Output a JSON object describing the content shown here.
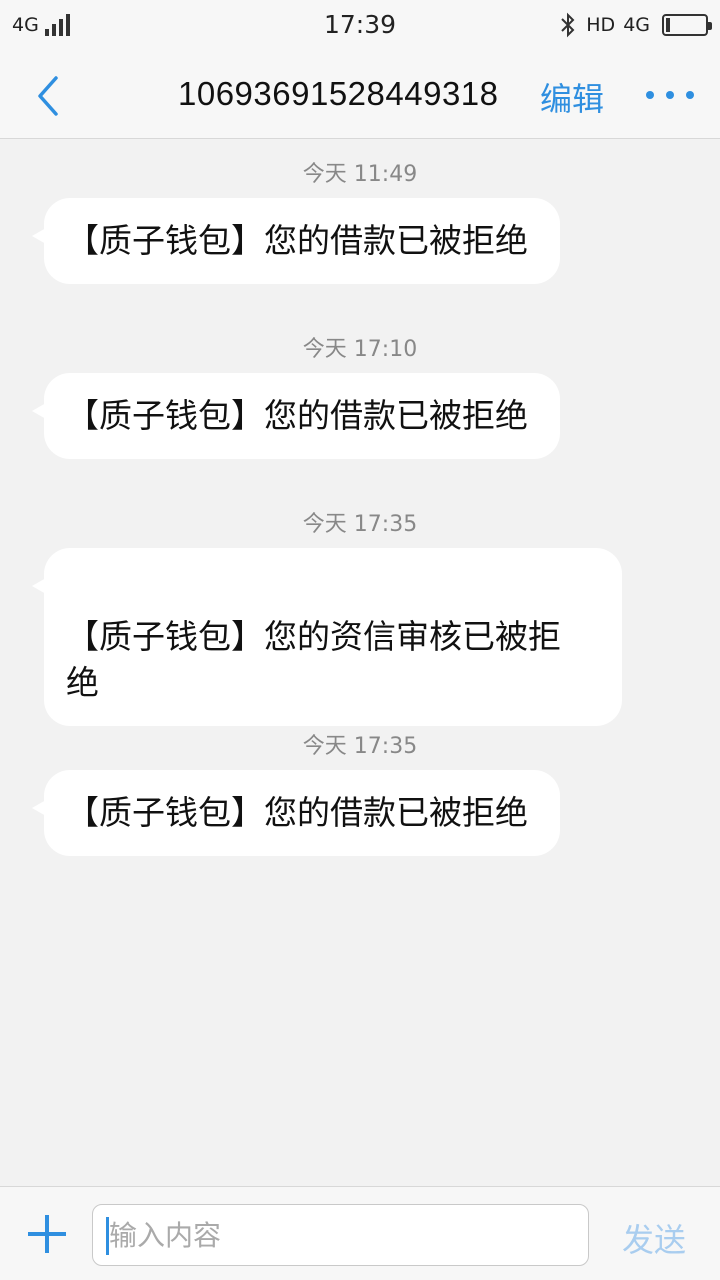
{
  "status_bar": {
    "network": "4G",
    "time": "17:39",
    "hd": "HD",
    "network_right": "4G",
    "icons": [
      "signal-icon",
      "bluetooth-icon",
      "battery-icon"
    ]
  },
  "header": {
    "title": "10693691528449318",
    "edit_label": "编辑",
    "icons": [
      "back-arrow-icon",
      "more-dots-icon"
    ]
  },
  "messages": [
    {
      "time": "今天 11:49",
      "text": "【质子钱包】您的借款已被拒绝"
    },
    {
      "time": "今天 17:10",
      "text": "【质子钱包】您的借款已被拒绝"
    },
    {
      "time": "今天 17:35",
      "text": "【质子钱包】您的资信审核已被拒\n绝"
    },
    {
      "time": "今天 17:35",
      "text": "【质子钱包】您的借款已被拒绝"
    }
  ],
  "input_bar": {
    "placeholder": "输入内容",
    "value": "",
    "send_label": "发送",
    "icons": [
      "plus-icon"
    ]
  },
  "colors": {
    "accent": "#2f8fe0",
    "background": "#f2f2f2",
    "bubble": "#ffffff",
    "send_disabled": "#a9cdef"
  }
}
